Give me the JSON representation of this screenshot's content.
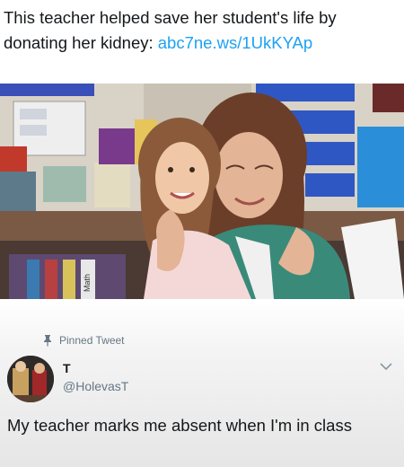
{
  "headline": {
    "text": "This teacher helped save her student's life by donating her kidney: ",
    "link": "abc7ne.ws/1UkKYAp"
  },
  "photo": {
    "shelf_label": "Math"
  },
  "tweet": {
    "pinned_label": "Pinned Tweet",
    "name": "T",
    "handle": "@HolevasT",
    "text": "My teacher marks me absent when I'm in class"
  },
  "colors": {
    "link": "#1da1f2",
    "secondary_text": "#657786"
  },
  "icons": {
    "pin": "pin-icon",
    "menu": "chevron-down-icon"
  }
}
